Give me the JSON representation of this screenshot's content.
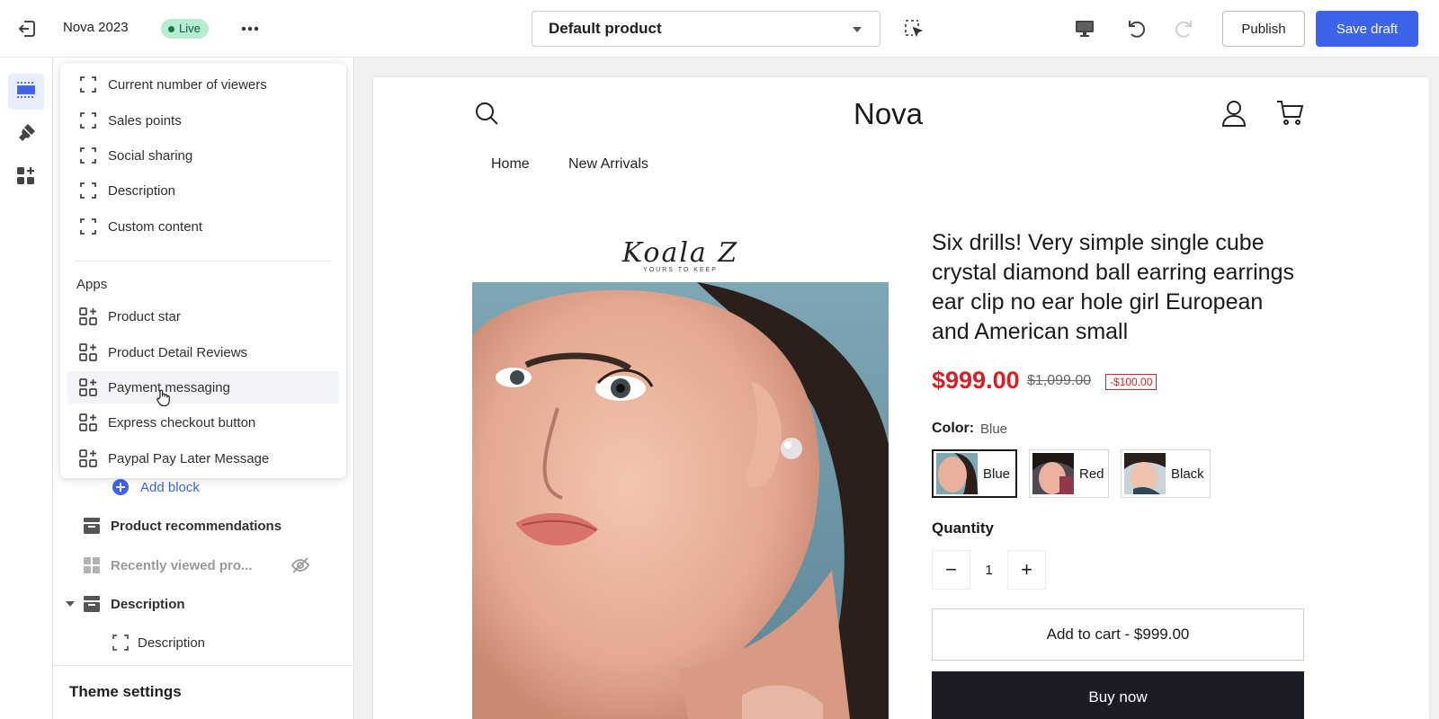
{
  "topbar": {
    "theme_name": "Nova 2023",
    "status": "Live",
    "template_select": "Default product",
    "publish_label": "Publish",
    "save_label": "Save draft"
  },
  "popover": {
    "blocks": [
      {
        "label": "Current number of viewers",
        "icon": "block-placeholder-icon"
      },
      {
        "label": "Sales points",
        "icon": "block-placeholder-icon"
      },
      {
        "label": "Social sharing",
        "icon": "block-placeholder-icon"
      },
      {
        "label": "Description",
        "icon": "block-placeholder-icon"
      },
      {
        "label": "Custom content",
        "icon": "block-placeholder-icon"
      }
    ],
    "apps_heading": "Apps",
    "apps": [
      {
        "label": "Product star",
        "icon": "app-block-icon"
      },
      {
        "label": "Product Detail Reviews",
        "icon": "app-block-icon"
      },
      {
        "label": "Payment messaging",
        "icon": "app-block-icon"
      },
      {
        "label": "Express checkout button",
        "icon": "app-block-icon"
      },
      {
        "label": "Paypal Pay Later Message",
        "icon": "app-block-icon"
      }
    ]
  },
  "sidebar": {
    "add_block": "Add block",
    "sections": [
      {
        "label": "Product recommendations"
      },
      {
        "label": "Recently viewed pro..."
      },
      {
        "label": "Description"
      },
      {
        "label": "Description"
      }
    ],
    "theme_settings": "Theme settings"
  },
  "preview": {
    "store_name": "Nova",
    "nav": [
      "Home",
      "New Arrivals"
    ],
    "brand_script": "Koala Z",
    "brand_tagline": "YOURS TO KEEP",
    "product_title": "Six drills! Very simple single cube crystal diamond ball earring earrings ear clip no ear hole girl European and American small",
    "price": "$999.00",
    "compare_price": "$1,099.00",
    "discount": "-$100.00",
    "color_label": "Color:",
    "color_value": "Blue",
    "swatches": [
      "Blue",
      "Red",
      "Black"
    ],
    "quantity_label": "Quantity",
    "quantity": "1",
    "add_to_cart": "Add to cart  -  $999.00",
    "buy_now": "Buy now"
  },
  "colors": {
    "accent": "#3d63ea",
    "live_badge": "#b8ecd0",
    "price_red": "#d81f26",
    "buy_now_bg": "#1c1c26"
  }
}
